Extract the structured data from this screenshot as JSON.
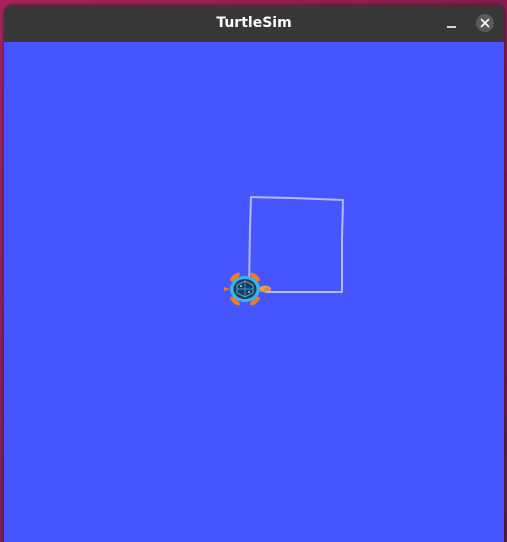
{
  "window": {
    "title": "TurtleSim"
  },
  "colors": {
    "titlebar": "#373737",
    "canvas_background": "#4556ff",
    "pen": "#b3b8ff",
    "turtle_shell": "#1f3a5a",
    "turtle_body": "#3fb2e6",
    "turtle_limbs": "#f07a24"
  },
  "icons": {
    "minimize": "minimize-icon",
    "close": "close-icon",
    "turtle": "turtle-icon"
  }
}
